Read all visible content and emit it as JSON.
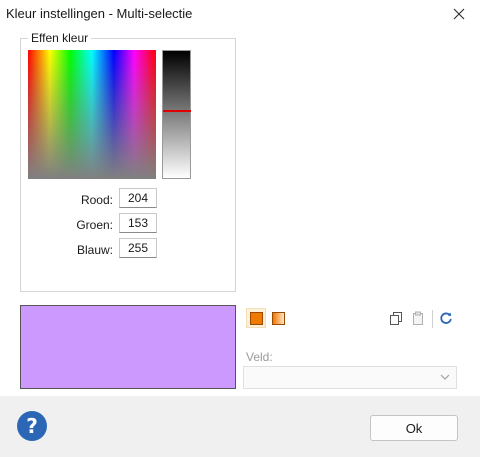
{
  "window": {
    "title": "Kleur instellingen - Multi-selectie"
  },
  "group": {
    "title": "Effen kleur"
  },
  "rgb": {
    "red_label": "Rood:",
    "red_value": "204",
    "green_label": "Groen:",
    "green_value": "153",
    "blue_label": "Blauw:",
    "blue_value": "255"
  },
  "preview": {
    "color": "#cc99ff"
  },
  "icons": {
    "close": "close-icon",
    "solid_mode": "solid-fill-icon",
    "gradient_mode": "gradient-fill-icon",
    "copy": "copy-icon",
    "paste": "paste-icon",
    "refresh": "refresh-icon",
    "help": "help-icon"
  },
  "field": {
    "label": "Veld:",
    "value": ""
  },
  "footer": {
    "help_glyph": "?",
    "ok_label": "Ok"
  },
  "colors": {
    "accent": "#f07a00",
    "help_blue": "#2c67b6",
    "luminance_marker": "#e00000"
  }
}
